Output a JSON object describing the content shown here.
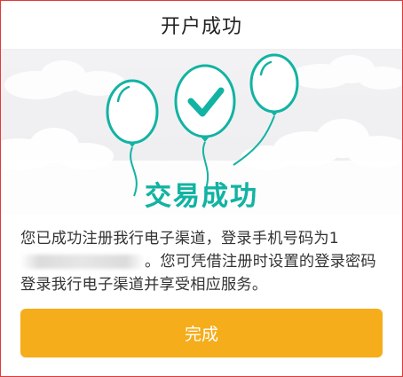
{
  "header": {
    "title": "开户成功"
  },
  "banner": {
    "success_label": "交易成功",
    "balloon_icon": "balloon-icon",
    "check_icon": "checkmark-icon",
    "accent_color": "#12b3a2"
  },
  "message": {
    "line1": "您已成功注册我行电子渠道，登录手机号码为1",
    "line2_suffix": "。您可凭借注册时设置的登录密码",
    "line3": "登录我行电子渠道并享受相应服务。"
  },
  "actions": {
    "done_label": "完成",
    "done_color": "#f5ad1b"
  }
}
